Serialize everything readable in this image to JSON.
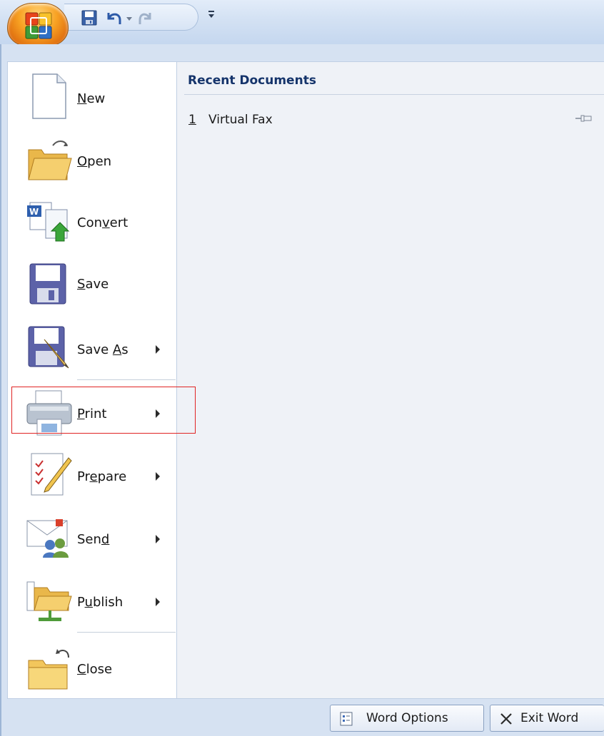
{
  "quick_access": {
    "items": [
      "save-icon",
      "undo-icon",
      "undo-dropdown-icon",
      "redo-icon",
      "customize-qat-icon"
    ]
  },
  "office_button": {
    "icon": "office-logo-icon"
  },
  "menu": {
    "items": [
      {
        "label": "New",
        "access_key": "N",
        "icon": "new-document-icon",
        "has_submenu": false
      },
      {
        "label": "Open",
        "access_key": "O",
        "icon": "open-folder-icon",
        "has_submenu": false
      },
      {
        "label": "Convert",
        "access_key": "v",
        "icon": "convert-icon",
        "has_submenu": false
      },
      {
        "label": "Save",
        "access_key": "S",
        "icon": "save-floppy-icon",
        "has_submenu": false
      },
      {
        "label": "Save As",
        "access_key": "A",
        "icon": "save-as-icon",
        "has_submenu": true
      },
      {
        "label": "Print",
        "access_key": "P",
        "icon": "printer-icon",
        "has_submenu": true
      },
      {
        "label": "Prepare",
        "access_key": "e",
        "icon": "prepare-icon",
        "has_submenu": true
      },
      {
        "label": "Send",
        "access_key": "d",
        "icon": "send-icon",
        "has_submenu": true
      },
      {
        "label": "Publish",
        "access_key": "u",
        "icon": "publish-icon",
        "has_submenu": true
      },
      {
        "label": "Close",
        "access_key": "C",
        "icon": "close-folder-icon",
        "has_submenu": false
      }
    ]
  },
  "recent": {
    "title": "Recent Documents",
    "items": [
      {
        "number": "1",
        "name": "Virtual Fax",
        "icon": "pin-icon"
      }
    ]
  },
  "footer": {
    "options_label": "Word Options",
    "exit_label": "Exit Word"
  },
  "colors": {
    "highlight": "#e02424",
    "recent_title": "#15346b",
    "menu_background": "#d6e2f2"
  }
}
